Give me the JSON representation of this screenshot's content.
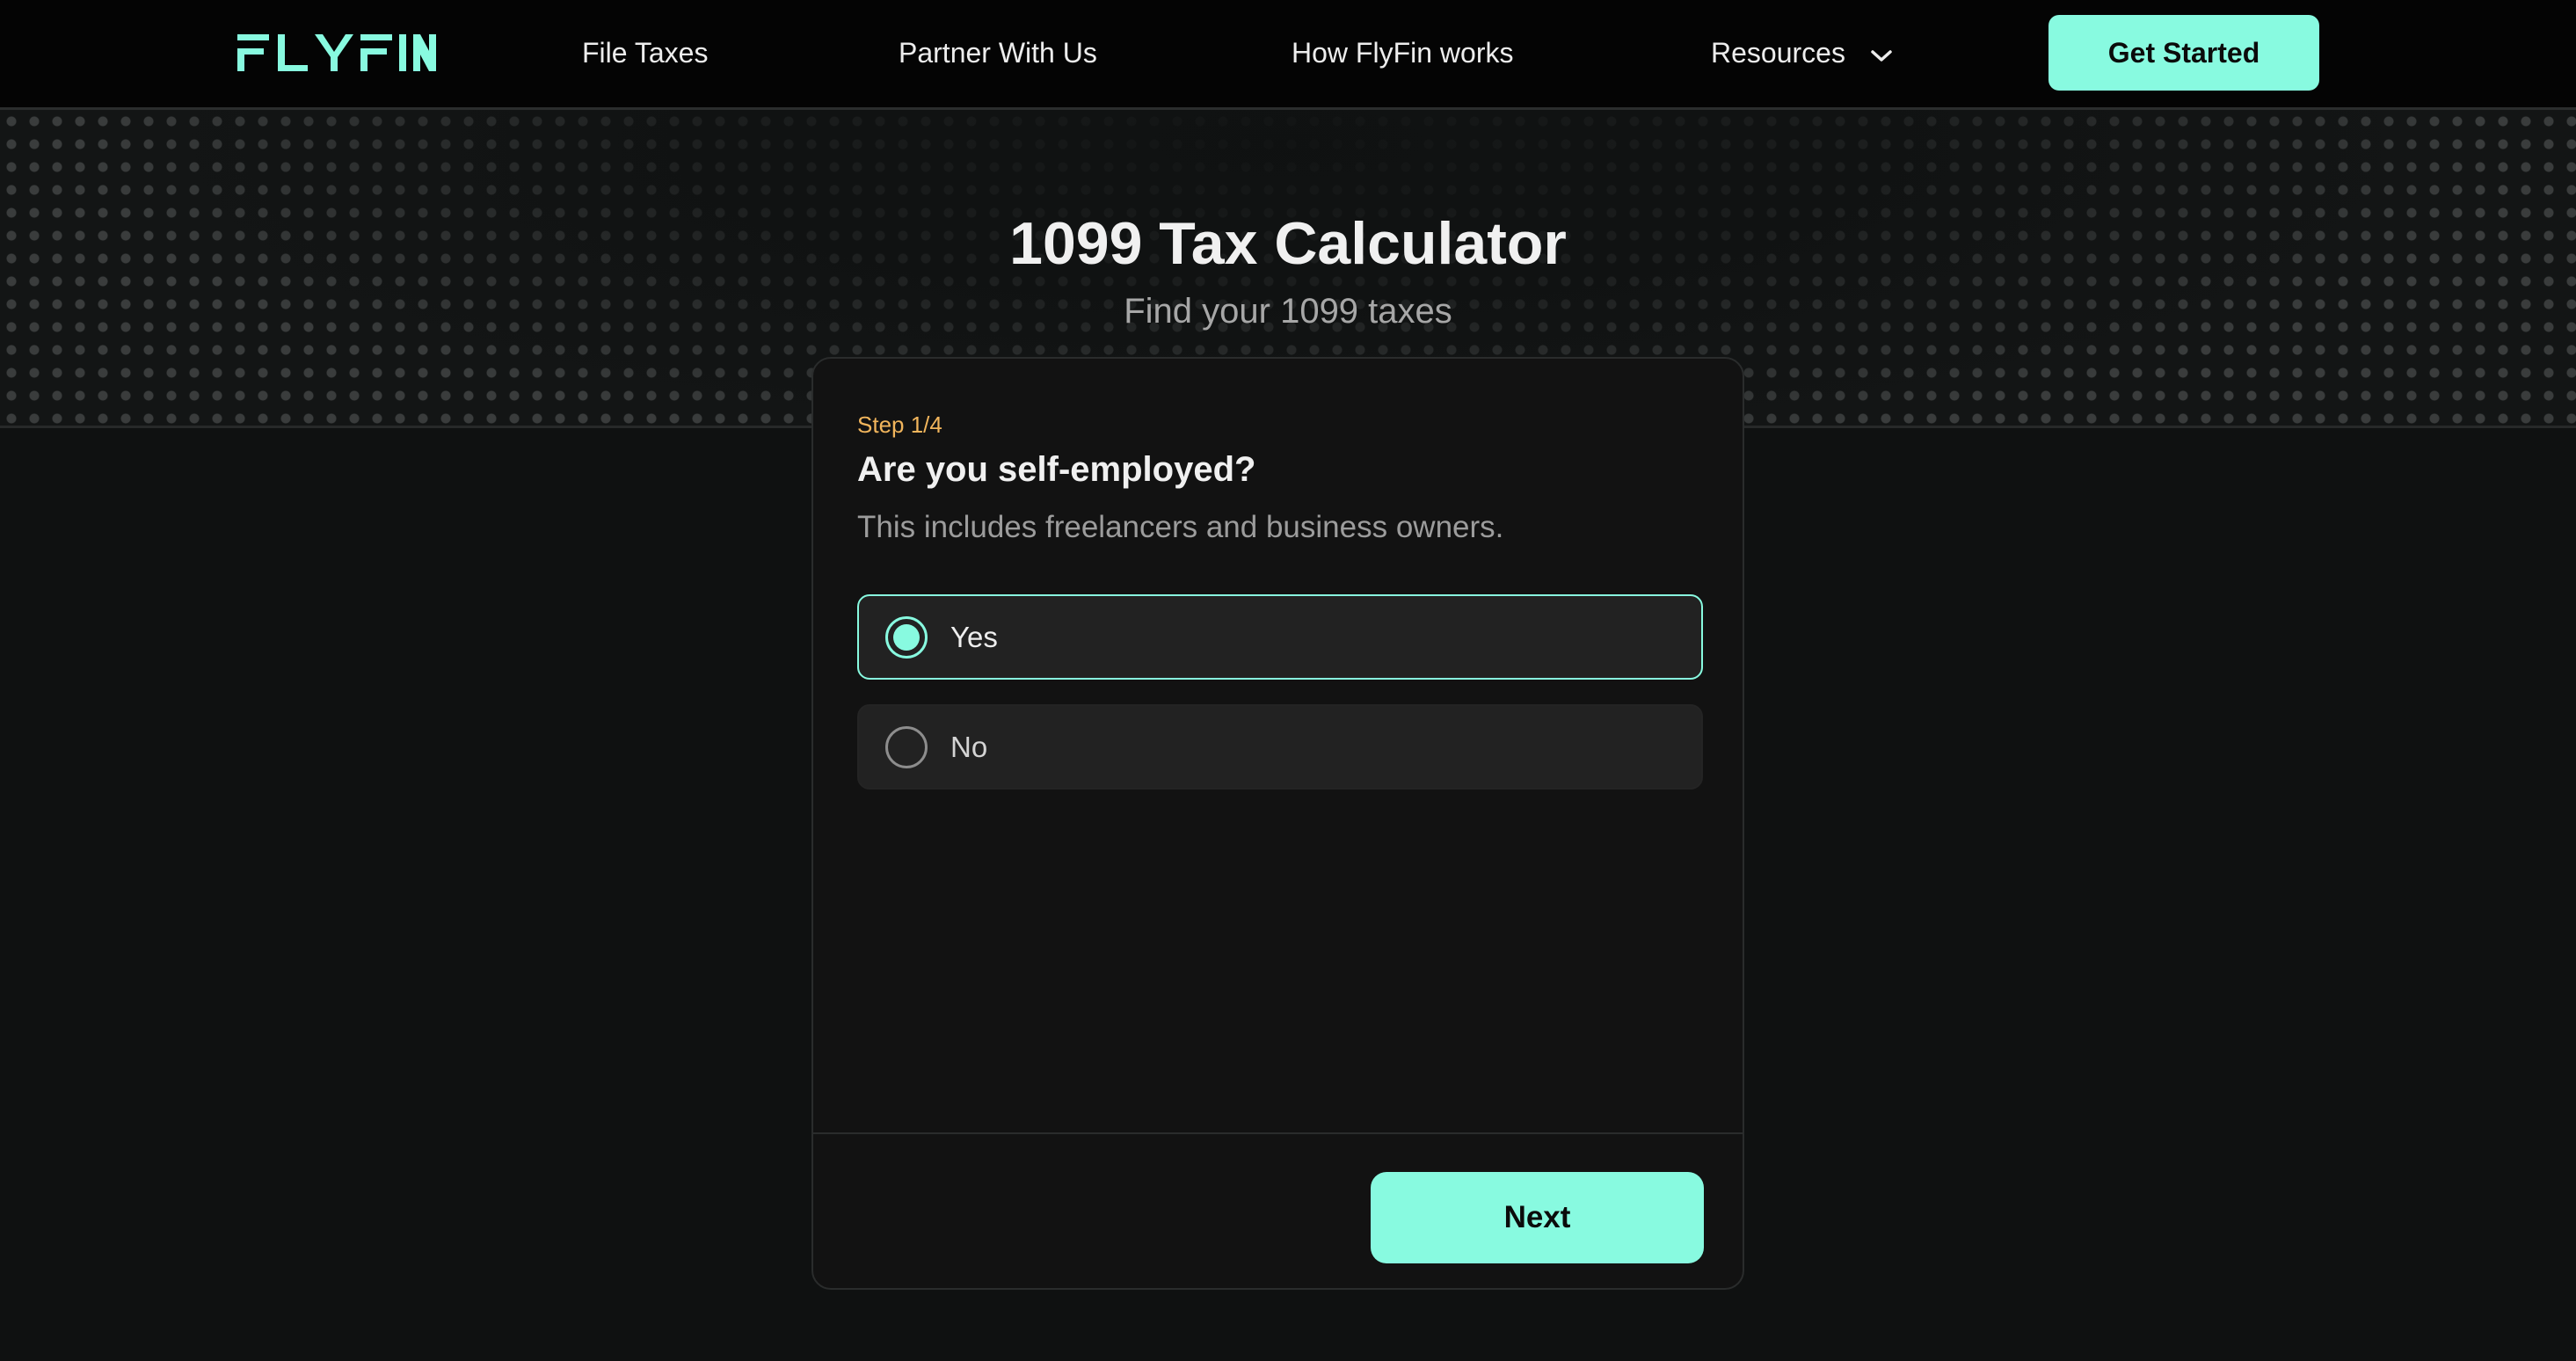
{
  "header": {
    "logo_text": "FLYFIN",
    "nav": {
      "file_taxes": "File Taxes",
      "partner": "Partner With Us",
      "how": "How FlyFin works",
      "resources": "Resources"
    },
    "cta_label": "Get Started"
  },
  "hero": {
    "title": "1099 Tax Calculator",
    "subtitle": "Find your 1099 taxes"
  },
  "card": {
    "step": "Step 1/4",
    "question": "Are you self-employed?",
    "help_text": "This includes freelancers and business owners.",
    "options": [
      {
        "label": "Yes",
        "selected": true
      },
      {
        "label": "No",
        "selected": false
      }
    ],
    "next_label": "Next"
  },
  "colors": {
    "accent": "#88fae0",
    "step_color": "#f1b55c",
    "background": "#0f1111"
  },
  "icons": {
    "logo": "flyfin-logo",
    "resources_chevron": "chevron-down-icon"
  }
}
